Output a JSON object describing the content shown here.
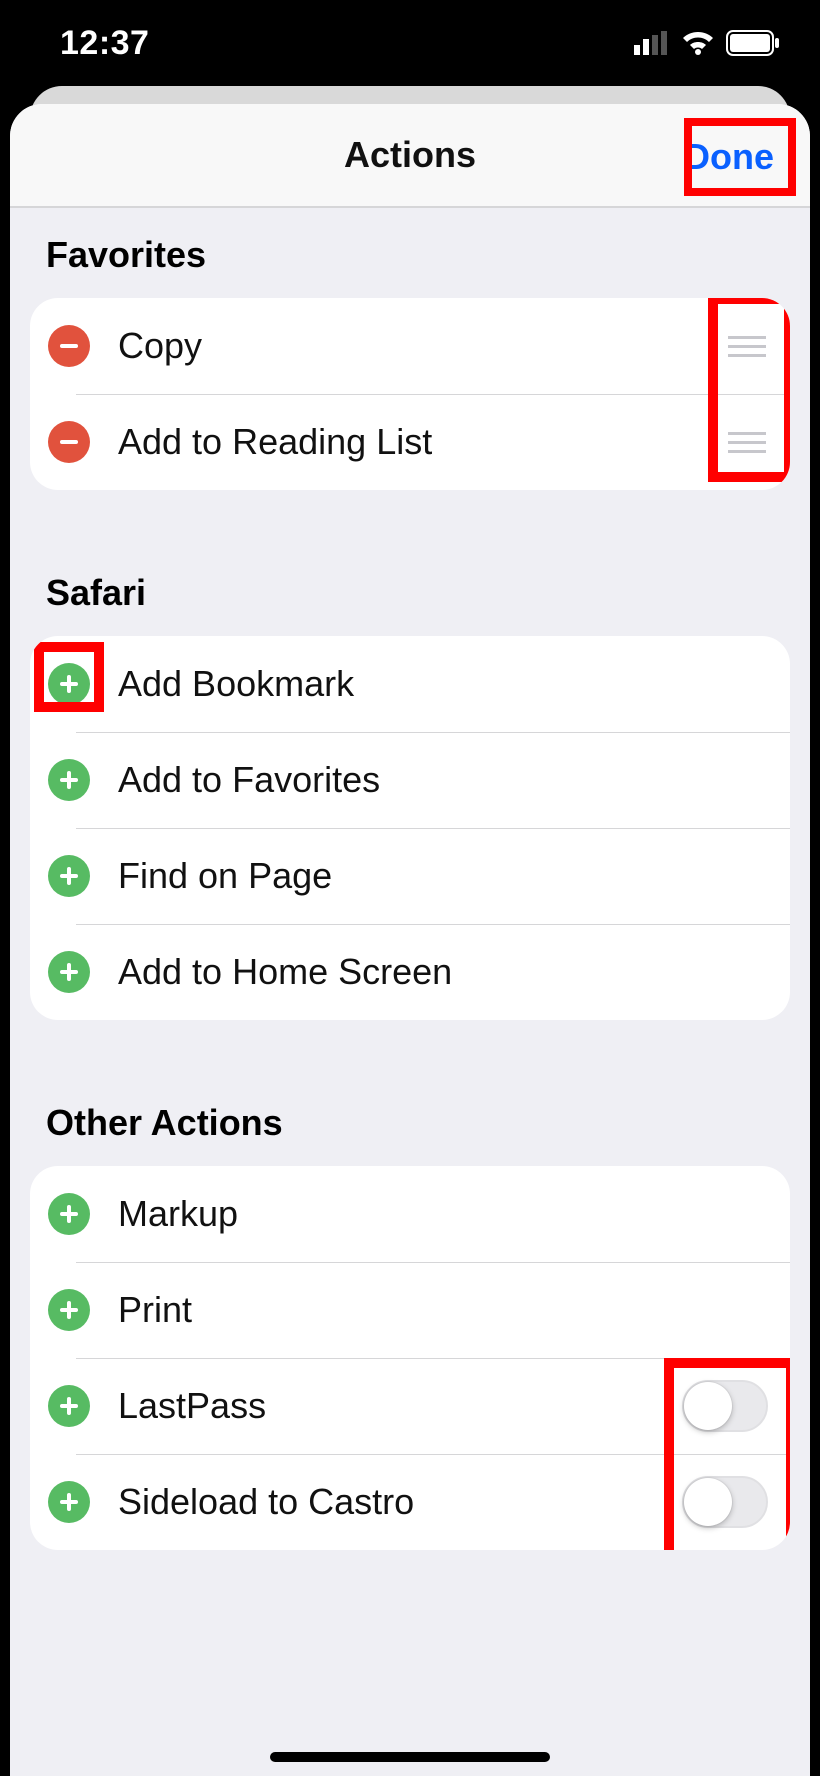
{
  "statusbar": {
    "time": "12:37"
  },
  "navbar": {
    "title": "Actions",
    "done": "Done"
  },
  "sections": {
    "favorites": {
      "header": "Favorites",
      "items": [
        {
          "label": "Copy"
        },
        {
          "label": "Add to Reading List"
        }
      ]
    },
    "safari": {
      "header": "Safari",
      "items": [
        {
          "label": "Add Bookmark"
        },
        {
          "label": "Add to Favorites"
        },
        {
          "label": "Find on Page"
        },
        {
          "label": "Add to Home Screen"
        }
      ]
    },
    "other": {
      "header": "Other Actions",
      "items": [
        {
          "label": "Markup"
        },
        {
          "label": "Print"
        },
        {
          "label": "LastPass"
        },
        {
          "label": "Sideload to Castro"
        }
      ]
    }
  }
}
